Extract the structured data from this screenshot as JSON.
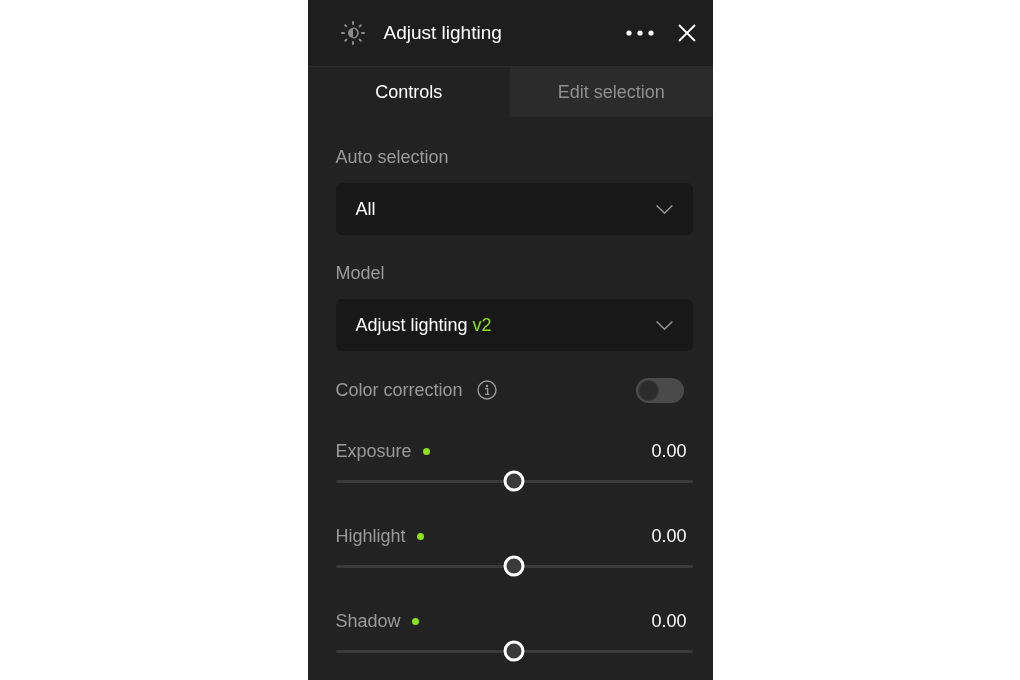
{
  "panel": {
    "title": "Adjust lighting"
  },
  "tabs": [
    {
      "label": "Controls",
      "selected": true
    },
    {
      "label": "Edit selection",
      "selected": false
    }
  ],
  "dropdowns": [
    {
      "label": "Auto selection",
      "value": "All"
    },
    {
      "label": "Model",
      "value": "Adjust lighting",
      "version": "v2"
    }
  ],
  "color_correction": {
    "label": "Color correction",
    "on": false
  },
  "sliders": [
    {
      "name": "Exposure",
      "indicator": true,
      "reading": "0.00",
      "level": 0.5
    },
    {
      "name": "Highlight",
      "indicator": true,
      "reading": "0.00",
      "level": 0.5
    },
    {
      "name": "Shadow",
      "indicator": true,
      "reading": "0.00",
      "level": 0.5
    }
  ]
}
